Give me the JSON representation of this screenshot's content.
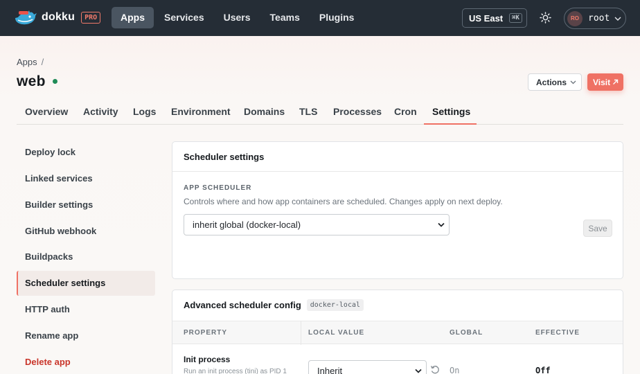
{
  "topbar": {
    "logo_text": "dokku",
    "pro_badge": "PRO",
    "nav": [
      "Apps",
      "Services",
      "Users",
      "Teams",
      "Plugins"
    ],
    "active_nav": "Apps",
    "region": "US East",
    "region_shortcut": "⌘K",
    "user_initials": "RO",
    "user_name": "root"
  },
  "header": {
    "breadcrumb_root": "Apps",
    "breadcrumb_sep": "/",
    "app_name": "web",
    "actions_label": "Actions",
    "visit_label": "Visit"
  },
  "tabs": [
    "Overview",
    "Activity",
    "Logs",
    "Environment",
    "Domains",
    "TLS",
    "Processes",
    "Cron",
    "Settings"
  ],
  "active_tab": "Settings",
  "sidebar": {
    "items": [
      "Deploy lock",
      "Linked services",
      "Builder settings",
      "GitHub webhook",
      "Buildpacks",
      "Scheduler settings",
      "HTTP auth",
      "Rename app",
      "Delete app"
    ],
    "active": "Scheduler settings"
  },
  "scheduler_card": {
    "title": "Scheduler settings",
    "section_label": "APP SCHEDULER",
    "help": "Controls where and how app containers are scheduled. Changes apply on next deploy.",
    "select_value": "inherit global (docker-local)",
    "save_label": "Save"
  },
  "advanced_card": {
    "title": "Advanced scheduler config",
    "badge": "docker-local",
    "columns": [
      "PROPERTY",
      "LOCAL VALUE",
      "GLOBAL",
      "EFFECTIVE"
    ],
    "rows": [
      {
        "property": "Init process",
        "description": "Run an init process (tini) as PID 1",
        "local_value": "Inherit",
        "global": "On",
        "effective": "Off"
      }
    ]
  },
  "colors": {
    "accent": "#ef7164",
    "topbar": "#252d36",
    "status_ok": "#1f8b57",
    "danger": "#c9362b"
  }
}
